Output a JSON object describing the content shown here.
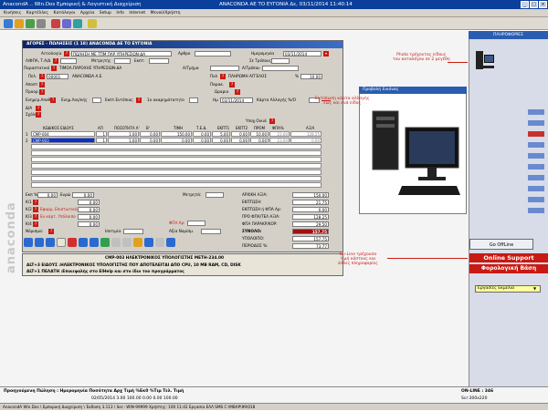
{
  "app": {
    "title": "AnacondA .. Win.Dos  Εμπορική & Λογιστική Διαχείριση",
    "company_date": "ANACONDA AE TO ΕΥΓΟΝΙΑ        Δε, 03/11/2014 11:40:14"
  },
  "menu": [
    "Κινήσεις",
    "Καρτέλλες",
    "Κατάλογοι",
    "Αρχεία",
    "Setup",
    "Info",
    "Internet",
    "Μενού/Χρήστη"
  ],
  "main_window": {
    "title": "ΑΓΟΡΕΣ - ΠΩΛΗΣΕΙΣ   (1 18)            ANACONDA AE TO ΕΥΓΟΝΙΑ",
    "labels": {
      "aitiologia": "Αιτιολογία",
      "af_fpa": "Λ/ΦΠΑ, Τ.Α/Δ",
      "parastatiko": "Παραστατικό",
      "pel": "Πελ.",
      "apostoli": "Αποστ.",
      "proor": "Προορ.",
      "energ": "Ενημερ.Αποθ.",
      "af": "Δ/Α",
      "sxolio": "Σχόλιο",
      "arthro": "Αρθρο",
      "metritis": "Μετρητής",
      "parak": "Παρακ.",
      "ekpt_logou": "Ενημ.Λογ/κής",
      "ekpt_entop": "Εκπτ.Εντόπιας",
      "imerominia": "Ημερομηνία",
      "se_toposi": "Σε Τρόπους",
      "arithmos": "Α/Τμήμα",
      "orario": "Ωραριο",
      "anak": "1ο ακαρημάτατητο",
      "im": "Ημ",
      "kartela": "Κάρτα Αλλαγής %/Ο",
      "ypolanal": "Υποχ.Οικιά"
    },
    "values": {
      "aitiologia": "ΠΩΛΗΣΗ ΜΕ ΤΠΜ.ΠΑΡ.ΥΠΗΡΕΣΙΩΝ-ΔΑ",
      "parastatiko": "ΤΙΜΟΛ.ΠΑΡΟΧΗΣ ΥΠΗΡΕΣΙΩΝ-ΔΑ",
      "pel_code": "00001",
      "pel_name": "ANACONDA A.E.",
      "pel_right": "ΠΛΗΡΩΜΗ ΑΓΓΕΛΟΣ",
      "perc": "10.00",
      "date": "03/11/2014",
      "im_date": "03/11/2014"
    },
    "columns": [
      "ΚΩΔΙΚΟΣ ΕΙΔΟΥΣ",
      "ΑΠ",
      "ΠΟΣΟΤΗΤΑ Α'",
      "Β'",
      "ΤΙΜΗ",
      "Τ.Ε.Δ.",
      "ΕΚΠΤ1",
      "ΕΚΠΤ2",
      "ΠΡΟΜ",
      "ΦΠΑ%",
      "ΑΞΙΑ"
    ],
    "rows": [
      {
        "n": "1",
        "code": "CMP-004",
        "ap": "1",
        "qty": "1.00",
        "qb": "0.00",
        "price": "150.00",
        "ted": "0.00",
        "e1": "5.00",
        "e2": "0.00",
        "prom": "10.00",
        "vat": "23.00",
        "amount": "128.25"
      },
      {
        "n": "2",
        "code": "CMP-003",
        "ap": "1",
        "qty": "1.00",
        "qb": "0.00",
        "price": "0.00",
        "ted": "0.00",
        "e1": "0.00",
        "e2": "0.00",
        "prom": "0.00",
        "vat": "23.00",
        "amount": "0.00"
      }
    ],
    "totals_labels": {
      "ekpt": "Εκπ %",
      "euro": "Ευρώ",
      "metritis": "Μετρητά:",
      "arxiki": "ΑΡΧΙΚΗ ΑΞΙΑ:",
      "ekptosi": "ΕΚΠΤΩΣΗ:",
      "ekpt_fpa": "ΕΚΠΤΩΣΗ ή ΦΠΑ Αρ:",
      "pro_fpa": "ΠΡΟ ΦΠΑ/ΤΕΛ ΑΞΙΑ:",
      "fpa": "ΦΠΑ:",
      "fpa_parakat": "ΦΠΑ ΠΑΡΑΚΡ/ΚΟΡ:",
      "synolo": "ΣΥΝΟΛΟ:",
      "ypoloipo": "ΥΠΟΛΟΙΠΟ:",
      "periodos": "ΠΕΡΙΟΔΟΣ %:",
      "ks1": "Κ/1",
      "ks2": "Κ/2",
      "ks3": "Κ/3",
      "ks4": "Κ/4",
      "nomismata": "Νόμισμα:",
      "isotimia": "Ισοτιμία",
      "axia_nomismatos": "Αξία Νομίσμ.",
      "fpa_ar": "ΦΠΑ Αρ:"
    },
    "totals_values": {
      "ekpt": "0.00",
      "euro": "0.00",
      "arxiki": "150.00",
      "ekptosi": "21.75",
      "ekpt_fpa": "0.00",
      "pro_fpa": "128.25",
      "fpa": "29.50",
      "synolo": "157.75",
      "ypoloipo": "157.75",
      "periodos": "73.77",
      "ks1": "0.00",
      "ks2": "0.00",
      "ks3": "0.00",
      "ks4": "0.00"
    },
    "k_notes": {
      "k2": "Εφαρμ. Επιστωτικής Κάρτ",
      "k3": "Ευ κάρτ. Υπόλοιπο"
    }
  },
  "footer_lines": [
    "CMP-003  ΗΛΕΚΤΡΟΝΙΚΟΣ ΥΠΟΛΟΓΙΣΤΗΣ ΜΕΤΗ-234.00",
    "ALT+3 ΕΙΔΟΥΣ :ΗΛΕΚΤΡΟΝΙΚΟΣ ΥΠΟΛΟΓΙΣΤΗΣ ΠΟΥ ΑΠΟΤΕΛΕΙΤΑΙ ΑΠΟ CPU, 10 MB RAM, CD, DISK",
    "ALT+1 ΠΕΛΑΤΗ :Επικεφαλής στο ElHelp  και στο ίδιο του προγράμματος"
  ],
  "photo_window": {
    "title": "Προβολή Εικόνας"
  },
  "notes": {
    "photo": "Photo τρέχοντος είδους\nτου καταλόγου σε 2 μεγέθη",
    "ekptosi": "Εκτύπωση κάρτα αλλαγής\nέως και ανά είδος",
    "online": "On-Line τρέχουσα\nτιμή κόστους και\nάλλες πληροφορίες"
  },
  "right_panel": {
    "header": "ΠΛΗΡΟΦΟΡΙΕΣ",
    "online_button": "Go OffLine",
    "online_support": "Online Support",
    "forologiki": "Φορολογική Βάση",
    "select_value": "Εργασίες Εκμελια"
  },
  "status": {
    "headers": "Προηγούμενη Πώληση : Ημερομηνία      Ποσότητα      Αρχ Τιμή   %Εκ0   %Τιμ   Τελ. Τιμή",
    "values": "02/05/2014          3.00          100.00   0.00   0.00   100.00",
    "online": "ON-LINE : 346",
    "scr": "Scr:300x220",
    "bottom": "AnacondA Win.Dos \\ Εμπορική Διαχείριση \\ Έκδοση 3.113 \\ Ser.: WIN-99999    Χρήστης: 100   11:42   Εργασία    ΕΛΛ    SMS    C:\\MBAP\\99\\018"
  },
  "colors": {
    "titlebar": "#0a3f9c",
    "required_badge": "#c81a12",
    "selected_row": "#0a2fd0"
  }
}
